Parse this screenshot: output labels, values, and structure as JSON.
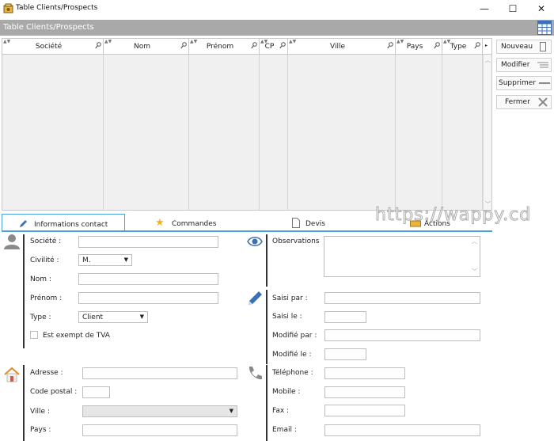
{
  "window": {
    "title": "Table Clients/Prospects",
    "minimize": "—",
    "maximize": "☐",
    "close": "✕"
  },
  "header": {
    "title": "Table Clients/Prospects"
  },
  "table": {
    "columns": [
      "Société",
      "Nom",
      "Prénom",
      "CP",
      "Ville",
      "Pays",
      "Type"
    ],
    "rows": []
  },
  "side_buttons": {
    "new": "Nouveau",
    "edit": "Modifier",
    "delete": "Supprimer",
    "close": "Fermer"
  },
  "tabs": {
    "items": [
      "Informations contact",
      "Commandes",
      "Devis",
      "Actions"
    ],
    "active": "Informations contact"
  },
  "watermark": "https://wappy.cd",
  "form": {
    "societe_label": "Société :",
    "societe_value": "",
    "civilite_label": "Civilité :",
    "civilite_value": "M.",
    "nom_label": "Nom :",
    "nom_value": "",
    "prenom_label": "Prénom :",
    "prenom_value": "",
    "type_label": "Type :",
    "type_value": "Client",
    "tva_label": "Est exempt de TVA",
    "tva_checked": false,
    "observations_label": "Observations",
    "observations_value": "",
    "saisi_par_label": "Saisi par :",
    "saisi_le_label": "Saisi le :",
    "modifie_par_label": "Modifié par :",
    "modifie_le_label": "Modifié le :",
    "adresse_label": "Adresse :",
    "code_postal_label": "Code postal :",
    "ville_label": "Ville :",
    "ville_value": "",
    "pays_label": "Pays :",
    "telephone_label": "Téléphone :",
    "mobile_label": "Mobile :",
    "fax_label": "Fax :",
    "email_label": "Email :"
  },
  "colors": {
    "header_band": "#a9a9a9",
    "tab_accent": "#4aa3d8",
    "icon_gray": "#8a8a8a",
    "icon_blue": "#3b6fb6"
  }
}
